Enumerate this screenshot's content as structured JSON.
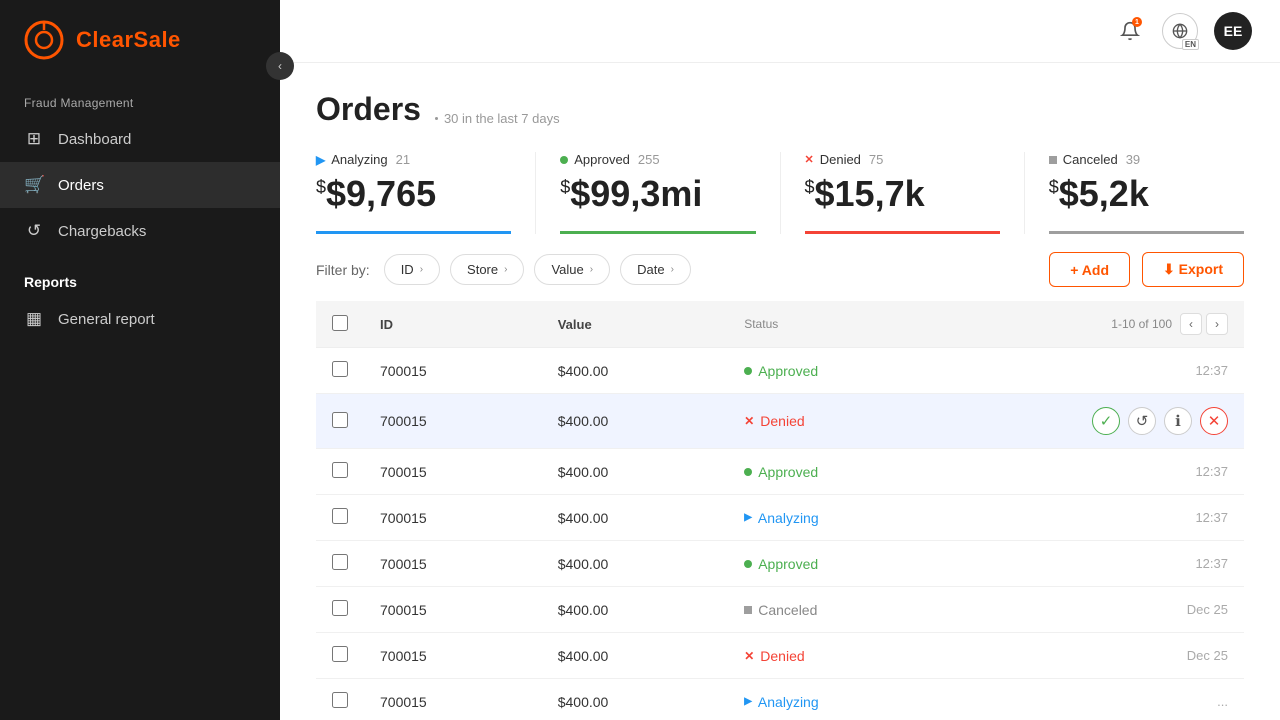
{
  "sidebar": {
    "logo_text": "ClearSale",
    "toggle_icon": "‹",
    "fraud_management_label": "Fraud Management",
    "nav_items": [
      {
        "id": "dashboard",
        "icon": "⊞",
        "label": "Dashboard",
        "active": false
      },
      {
        "id": "orders",
        "icon": "🛒",
        "label": "Orders",
        "active": true
      },
      {
        "id": "chargebacks",
        "icon": "↺",
        "label": "Chargebacks",
        "active": false
      }
    ],
    "reports_label": "Reports",
    "reports_items": [
      {
        "id": "general-report",
        "icon": "▦",
        "label": "General report",
        "active": false
      }
    ]
  },
  "topbar": {
    "notification_count": "1",
    "lang": "EN",
    "avatar_initials": "EE"
  },
  "page": {
    "title": "Orders",
    "subtitle": "30 in the last 7 days"
  },
  "stats": [
    {
      "id": "analyzing",
      "indicator": "triangle",
      "label": "Analyzing",
      "count": "21",
      "value": "$9,765",
      "type": "analyzing"
    },
    {
      "id": "approved",
      "indicator": "dot-green",
      "label": "Approved",
      "count": "255",
      "value": "$99,3mi",
      "type": "approved"
    },
    {
      "id": "denied",
      "indicator": "x-red",
      "label": "Denied",
      "count": "75",
      "value": "$15,7k",
      "type": "denied"
    },
    {
      "id": "canceled",
      "indicator": "sq-gray",
      "label": "Canceled",
      "count": "39",
      "value": "$5,2k",
      "type": "canceled"
    }
  ],
  "filters": {
    "label": "Filter by:",
    "items": [
      "ID",
      "Store",
      "Value",
      "Date"
    ],
    "add_label": "+ Add",
    "export_label": "⬇ Export"
  },
  "table": {
    "headers": {
      "id": "ID",
      "value": "Value",
      "status": "Status",
      "pagination": "1-10 of 100"
    },
    "rows": [
      {
        "id": "700015",
        "value": "$400.00",
        "status": "Approved",
        "status_type": "approved",
        "time": "12:37",
        "highlighted": false
      },
      {
        "id": "700015",
        "value": "$400.00",
        "status": "Denied",
        "status_type": "denied",
        "time": "",
        "highlighted": true,
        "has_actions": true
      },
      {
        "id": "700015",
        "value": "$400.00",
        "status": "Approved",
        "status_type": "approved",
        "time": "12:37",
        "highlighted": false
      },
      {
        "id": "700015",
        "value": "$400.00",
        "status": "Analyzing",
        "status_type": "analyzing",
        "time": "12:37",
        "highlighted": false
      },
      {
        "id": "700015",
        "value": "$400.00",
        "status": "Approved",
        "status_type": "approved",
        "time": "12:37",
        "highlighted": false
      },
      {
        "id": "700015",
        "value": "$400.00",
        "status": "Canceled",
        "status_type": "canceled",
        "time": "Dec 25",
        "highlighted": false
      },
      {
        "id": "700015",
        "value": "$400.00",
        "status": "Denied",
        "status_type": "denied",
        "time": "Dec 25",
        "highlighted": false
      },
      {
        "id": "700015",
        "value": "$400.00",
        "status": "Analyzing",
        "status_type": "analyzing",
        "time": "...",
        "highlighted": false
      }
    ]
  }
}
